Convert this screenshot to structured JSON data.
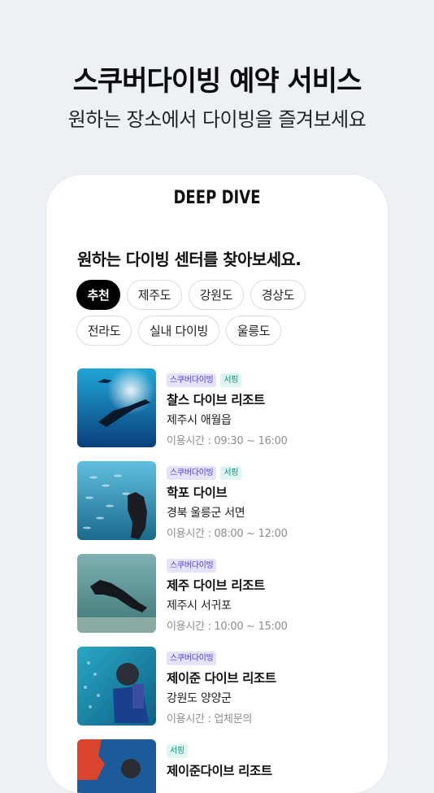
{
  "hero": {
    "title": "스쿠버다이빙 예약 서비스",
    "subtitle": "원하는 장소에서 다이빙을 즐겨보세요"
  },
  "app": {
    "logo": "DEEP DIVE",
    "section_title": "원하는 다이빙 센터를 찾아보세요.",
    "chips": [
      {
        "label": "추천",
        "active": true
      },
      {
        "label": "제주도",
        "active": false
      },
      {
        "label": "강원도",
        "active": false
      },
      {
        "label": "경상도",
        "active": false
      },
      {
        "label": "전라도",
        "active": false
      },
      {
        "label": "실내 다이빙",
        "active": false
      },
      {
        "label": "울릉도",
        "active": false
      }
    ],
    "centers": [
      {
        "tags": [
          "스쿠버다이빙",
          "서핑"
        ],
        "name": "찰스 다이브 리조트",
        "location": "제주시 애월읍",
        "hours": "이용시간 : 09:30 ~ 16:00"
      },
      {
        "tags": [
          "스쿠버다이빙",
          "서핑"
        ],
        "name": "학포 다이브",
        "location": "경북 울릉군 서면",
        "hours": "이용시간 : 08:00 ~ 12:00"
      },
      {
        "tags": [
          "스쿠버다이빙"
        ],
        "name": "제주 다이브 리조트",
        "location": "제주시 서귀포",
        "hours": "이용시간 : 10:00 ~ 15:00"
      },
      {
        "tags": [
          "스쿠버다이빙"
        ],
        "name": "제이준 다이브 리조트",
        "location": "강원도 양양군",
        "hours": "이용시간 : 업체문의"
      },
      {
        "tags": [
          "서핑"
        ],
        "name": "제이준다이브 리조트",
        "location": "",
        "hours": ""
      }
    ]
  }
}
